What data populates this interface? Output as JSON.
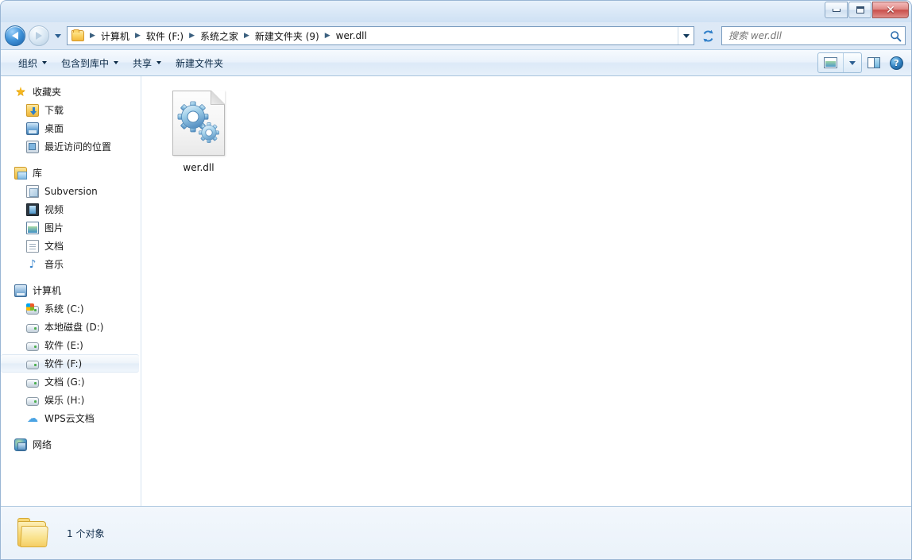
{
  "window": {
    "controls": {
      "minimize_label": "最小化",
      "maximize_label": "最大化",
      "close_label": "关闭"
    }
  },
  "navigation": {
    "back_label": "后退",
    "forward_label": "前进",
    "history_label": "最近浏览的页面",
    "refresh_label": "刷新",
    "address_dropdown_label": "以前的位置"
  },
  "breadcrumb": {
    "items": [
      {
        "label": "计算机"
      },
      {
        "label": "软件 (F:)"
      },
      {
        "label": "系统之家"
      },
      {
        "label": "新建文件夹 (9)"
      },
      {
        "label": "wer.dll"
      }
    ],
    "separator": "▶"
  },
  "search": {
    "value": "",
    "placeholder": "搜索 wer.dll",
    "icon": "search-icon"
  },
  "toolbar": {
    "items": [
      {
        "label": "组织",
        "has_caret": true
      },
      {
        "label": "包含到库中",
        "has_caret": true
      },
      {
        "label": "共享",
        "has_caret": true
      },
      {
        "label": "新建文件夹",
        "has_caret": false
      }
    ],
    "views_label": "更改您的视图",
    "views_caret_label": "更多选项",
    "preview_pane_label": "显示预览窗格",
    "help_label": "获取帮助",
    "help_glyph": "?"
  },
  "sidebar": {
    "groups": [
      {
        "name": "favorites",
        "root": {
          "label": "收藏夹",
          "icon": "star-icon"
        },
        "items": [
          {
            "label": "下载",
            "icon": "downloads-icon",
            "selected": false
          },
          {
            "label": "桌面",
            "icon": "desktop-icon",
            "selected": false
          },
          {
            "label": "最近访问的位置",
            "icon": "recent-places-icon",
            "selected": false
          }
        ]
      },
      {
        "name": "libraries",
        "root": {
          "label": "库",
          "icon": "library-icon"
        },
        "items": [
          {
            "label": "Subversion",
            "icon": "subversion-icon",
            "selected": false
          },
          {
            "label": "视频",
            "icon": "videos-icon",
            "selected": false
          },
          {
            "label": "图片",
            "icon": "pictures-icon",
            "selected": false
          },
          {
            "label": "文档",
            "icon": "documents-icon",
            "selected": false
          },
          {
            "label": "音乐",
            "icon": "music-icon",
            "selected": false
          }
        ]
      },
      {
        "name": "computer",
        "root": {
          "label": "计算机",
          "icon": "computer-icon"
        },
        "items": [
          {
            "label": "系统 (C:)",
            "icon": "system-drive-icon",
            "selected": false
          },
          {
            "label": "本地磁盘 (D:)",
            "icon": "drive-icon",
            "selected": false
          },
          {
            "label": "软件 (E:)",
            "icon": "drive-icon",
            "selected": false
          },
          {
            "label": "软件 (F:)",
            "icon": "drive-icon",
            "selected": true
          },
          {
            "label": "文档 (G:)",
            "icon": "drive-icon",
            "selected": false
          },
          {
            "label": "娱乐 (H:)",
            "icon": "drive-icon",
            "selected": false
          },
          {
            "label": "WPS云文档",
            "icon": "cloud-icon",
            "selected": false
          }
        ]
      },
      {
        "name": "network",
        "root": {
          "label": "网络",
          "icon": "network-icon"
        },
        "items": []
      }
    ]
  },
  "content": {
    "files": [
      {
        "name": "wer.dll",
        "icon": "dll-gears-icon",
        "selected": false
      }
    ]
  },
  "statusbar": {
    "text": "1 个对象",
    "icon": "folder-icon"
  },
  "colors": {
    "accent": "#2f7fc9",
    "titlebar_top": "#e9f2fb",
    "toolbar": "#eaf2fb",
    "selection": "#e3edf7",
    "frame_border": "#9ab6d4"
  }
}
